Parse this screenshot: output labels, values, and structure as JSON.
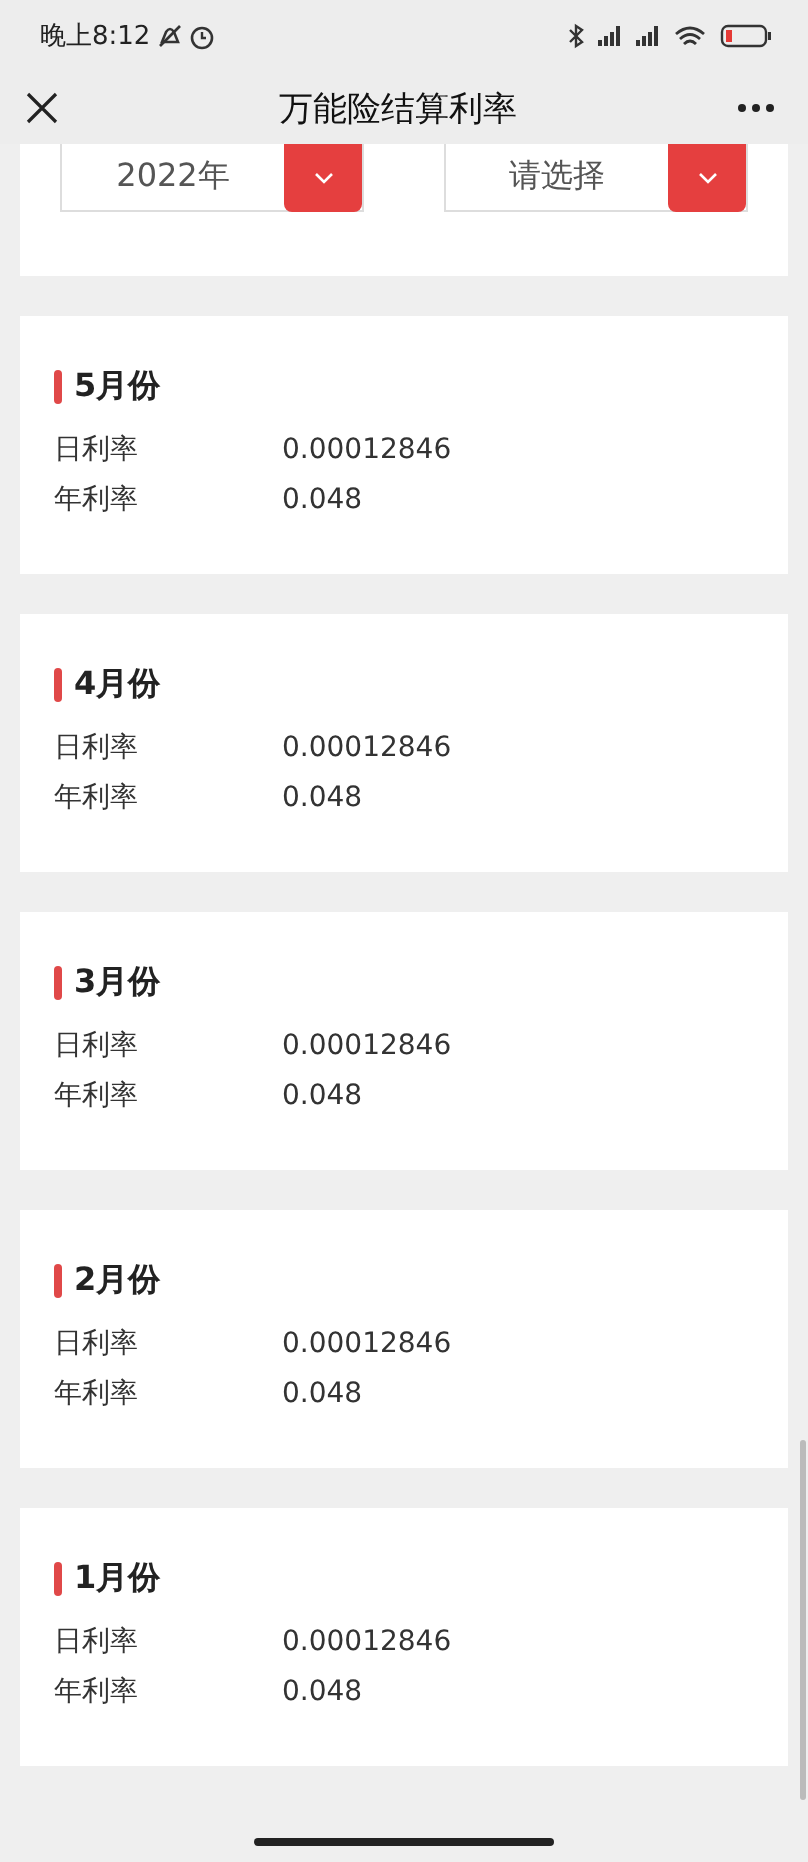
{
  "status_bar": {
    "time": "晚上8:12"
  },
  "nav": {
    "title": "万能险结算利率"
  },
  "filters": [
    {
      "value": "2022年"
    },
    {
      "value": "请选择"
    }
  ],
  "months": [
    {
      "title": "5月份",
      "rows": [
        {
          "label": "日利率",
          "value": "0.00012846"
        },
        {
          "label": "年利率",
          "value": "0.048"
        }
      ]
    },
    {
      "title": "4月份",
      "rows": [
        {
          "label": "日利率",
          "value": "0.00012846"
        },
        {
          "label": "年利率",
          "value": "0.048"
        }
      ]
    },
    {
      "title": "3月份",
      "rows": [
        {
          "label": "日利率",
          "value": "0.00012846"
        },
        {
          "label": "年利率",
          "value": "0.048"
        }
      ]
    },
    {
      "title": "2月份",
      "rows": [
        {
          "label": "日利率",
          "value": "0.00012846"
        },
        {
          "label": "年利率",
          "value": "0.048"
        }
      ]
    },
    {
      "title": "1月份",
      "rows": [
        {
          "label": "日利率",
          "value": "0.00012846"
        },
        {
          "label": "年利率",
          "value": "0.048"
        }
      ]
    }
  ]
}
